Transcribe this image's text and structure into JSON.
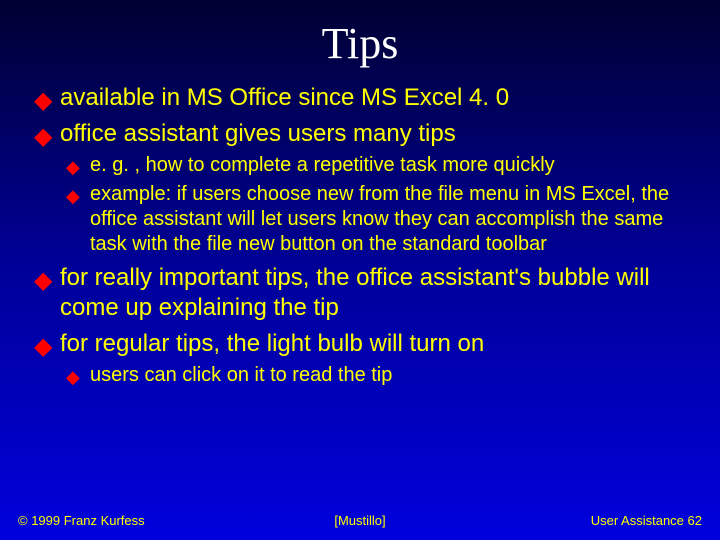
{
  "title": "Tips",
  "bullets": [
    {
      "level": 1,
      "text": "available in MS Office since MS Excel 4. 0"
    },
    {
      "level": 1,
      "text": "office assistant gives users many tips"
    },
    {
      "level": 2,
      "text": "e. g. , how to complete a repetitive task more quickly"
    },
    {
      "level": 2,
      "text": "example: if users choose new from the file menu in MS Excel, the office assistant will let users know they can accomplish the same task with the file new button on the standard toolbar"
    },
    {
      "level": 1,
      "text": "for really important tips, the office assistant's bubble will come up explaining the tip"
    },
    {
      "level": 1,
      "text": "for regular tips, the light bulb will turn on"
    },
    {
      "level": 2,
      "text": "users can click on it to read the tip"
    }
  ],
  "footer": {
    "left": "© 1999 Franz Kurfess",
    "center": "[Mustillo]",
    "right_label": "User Assistance",
    "right_page": "62"
  }
}
